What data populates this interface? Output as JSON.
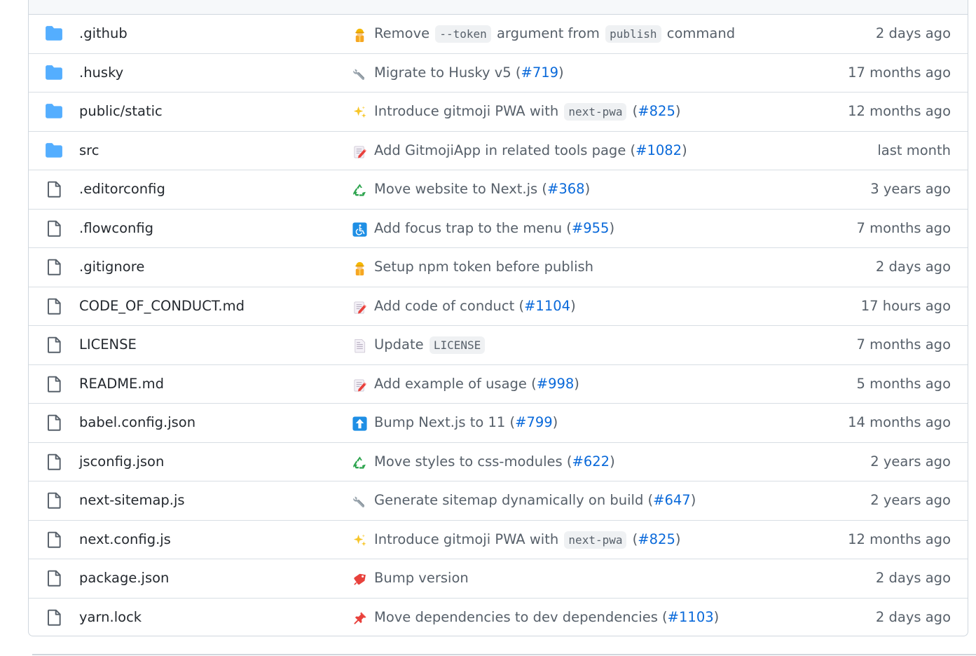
{
  "files": [
    {
      "name": ".github",
      "type": "folder",
      "emoji": "construction-worker",
      "message": [
        {
          "t": "text",
          "v": "Remove "
        },
        {
          "t": "code",
          "v": "--token"
        },
        {
          "t": "text",
          "v": " argument from "
        },
        {
          "t": "code",
          "v": "publish"
        },
        {
          "t": "text",
          "v": " command"
        }
      ],
      "age": "2 days ago"
    },
    {
      "name": ".husky",
      "type": "folder",
      "emoji": "wrench",
      "message": [
        {
          "t": "text",
          "v": "Migrate to Husky v5 ("
        },
        {
          "t": "pr",
          "v": "#719"
        },
        {
          "t": "text",
          "v": ")"
        }
      ],
      "age": "17 months ago"
    },
    {
      "name": "public/static",
      "type": "folder",
      "emoji": "sparkles",
      "message": [
        {
          "t": "text",
          "v": "Introduce gitmoji PWA with "
        },
        {
          "t": "code",
          "v": "next-pwa"
        },
        {
          "t": "text",
          "v": " ("
        },
        {
          "t": "pr",
          "v": "#825"
        },
        {
          "t": "text",
          "v": ")"
        }
      ],
      "age": "12 months ago"
    },
    {
      "name": "src",
      "type": "folder",
      "emoji": "memo",
      "message": [
        {
          "t": "text",
          "v": "Add GitmojiApp in related tools page ("
        },
        {
          "t": "pr",
          "v": "#1082"
        },
        {
          "t": "text",
          "v": ")"
        }
      ],
      "age": "last month"
    },
    {
      "name": ".editorconfig",
      "type": "file",
      "emoji": "recycle",
      "message": [
        {
          "t": "text",
          "v": "Move website to Next.js ("
        },
        {
          "t": "pr",
          "v": "#368"
        },
        {
          "t": "text",
          "v": ")"
        }
      ],
      "age": "3 years ago"
    },
    {
      "name": ".flowconfig",
      "type": "file",
      "emoji": "wheelchair",
      "message": [
        {
          "t": "text",
          "v": "Add focus trap to the menu ("
        },
        {
          "t": "pr",
          "v": "#955"
        },
        {
          "t": "text",
          "v": ")"
        }
      ],
      "age": "7 months ago"
    },
    {
      "name": ".gitignore",
      "type": "file",
      "emoji": "construction-worker",
      "message": [
        {
          "t": "text",
          "v": "Setup npm token before publish"
        }
      ],
      "age": "2 days ago"
    },
    {
      "name": "CODE_OF_CONDUCT.md",
      "type": "file",
      "emoji": "memo",
      "message": [
        {
          "t": "text",
          "v": "Add code of conduct ("
        },
        {
          "t": "pr",
          "v": "#1104"
        },
        {
          "t": "text",
          "v": ")"
        }
      ],
      "age": "17 hours ago"
    },
    {
      "name": "LICENSE",
      "type": "file",
      "emoji": "page-facing-up",
      "message": [
        {
          "t": "text",
          "v": "Update "
        },
        {
          "t": "code",
          "v": "LICENSE"
        }
      ],
      "age": "7 months ago"
    },
    {
      "name": "README.md",
      "type": "file",
      "emoji": "memo",
      "message": [
        {
          "t": "text",
          "v": "Add example of usage ("
        },
        {
          "t": "pr",
          "v": "#998"
        },
        {
          "t": "text",
          "v": ")"
        }
      ],
      "age": "5 months ago"
    },
    {
      "name": "babel.config.json",
      "type": "file",
      "emoji": "arrow-up",
      "message": [
        {
          "t": "text",
          "v": "Bump Next.js to 11 ("
        },
        {
          "t": "pr",
          "v": "#799"
        },
        {
          "t": "text",
          "v": ")"
        }
      ],
      "age": "14 months ago"
    },
    {
      "name": "jsconfig.json",
      "type": "file",
      "emoji": "recycle",
      "message": [
        {
          "t": "text",
          "v": "Move styles to css-modules ("
        },
        {
          "t": "pr",
          "v": "#622"
        },
        {
          "t": "text",
          "v": ")"
        }
      ],
      "age": "2 years ago"
    },
    {
      "name": "next-sitemap.js",
      "type": "file",
      "emoji": "wrench",
      "message": [
        {
          "t": "text",
          "v": "Generate sitemap dynamically on build ("
        },
        {
          "t": "pr",
          "v": "#647"
        },
        {
          "t": "text",
          "v": ")"
        }
      ],
      "age": "2 years ago"
    },
    {
      "name": "next.config.js",
      "type": "file",
      "emoji": "sparkles",
      "message": [
        {
          "t": "text",
          "v": "Introduce gitmoji PWA with "
        },
        {
          "t": "code",
          "v": "next-pwa"
        },
        {
          "t": "text",
          "v": " ("
        },
        {
          "t": "pr",
          "v": "#825"
        },
        {
          "t": "text",
          "v": ")"
        }
      ],
      "age": "12 months ago"
    },
    {
      "name": "package.json",
      "type": "file",
      "emoji": "bookmark",
      "message": [
        {
          "t": "text",
          "v": "Bump version"
        }
      ],
      "age": "2 days ago"
    },
    {
      "name": "yarn.lock",
      "type": "file",
      "emoji": "pushpin",
      "message": [
        {
          "t": "text",
          "v": "Move dependencies to dev dependencies ("
        },
        {
          "t": "pr",
          "v": "#1103"
        },
        {
          "t": "text",
          "v": ")"
        }
      ],
      "age": "2 days ago"
    }
  ],
  "colors": {
    "folder": "#54aeff",
    "file-icon": "#57606a",
    "link": "#0969da",
    "muted": "#57606a",
    "border": "#d0d7de"
  }
}
